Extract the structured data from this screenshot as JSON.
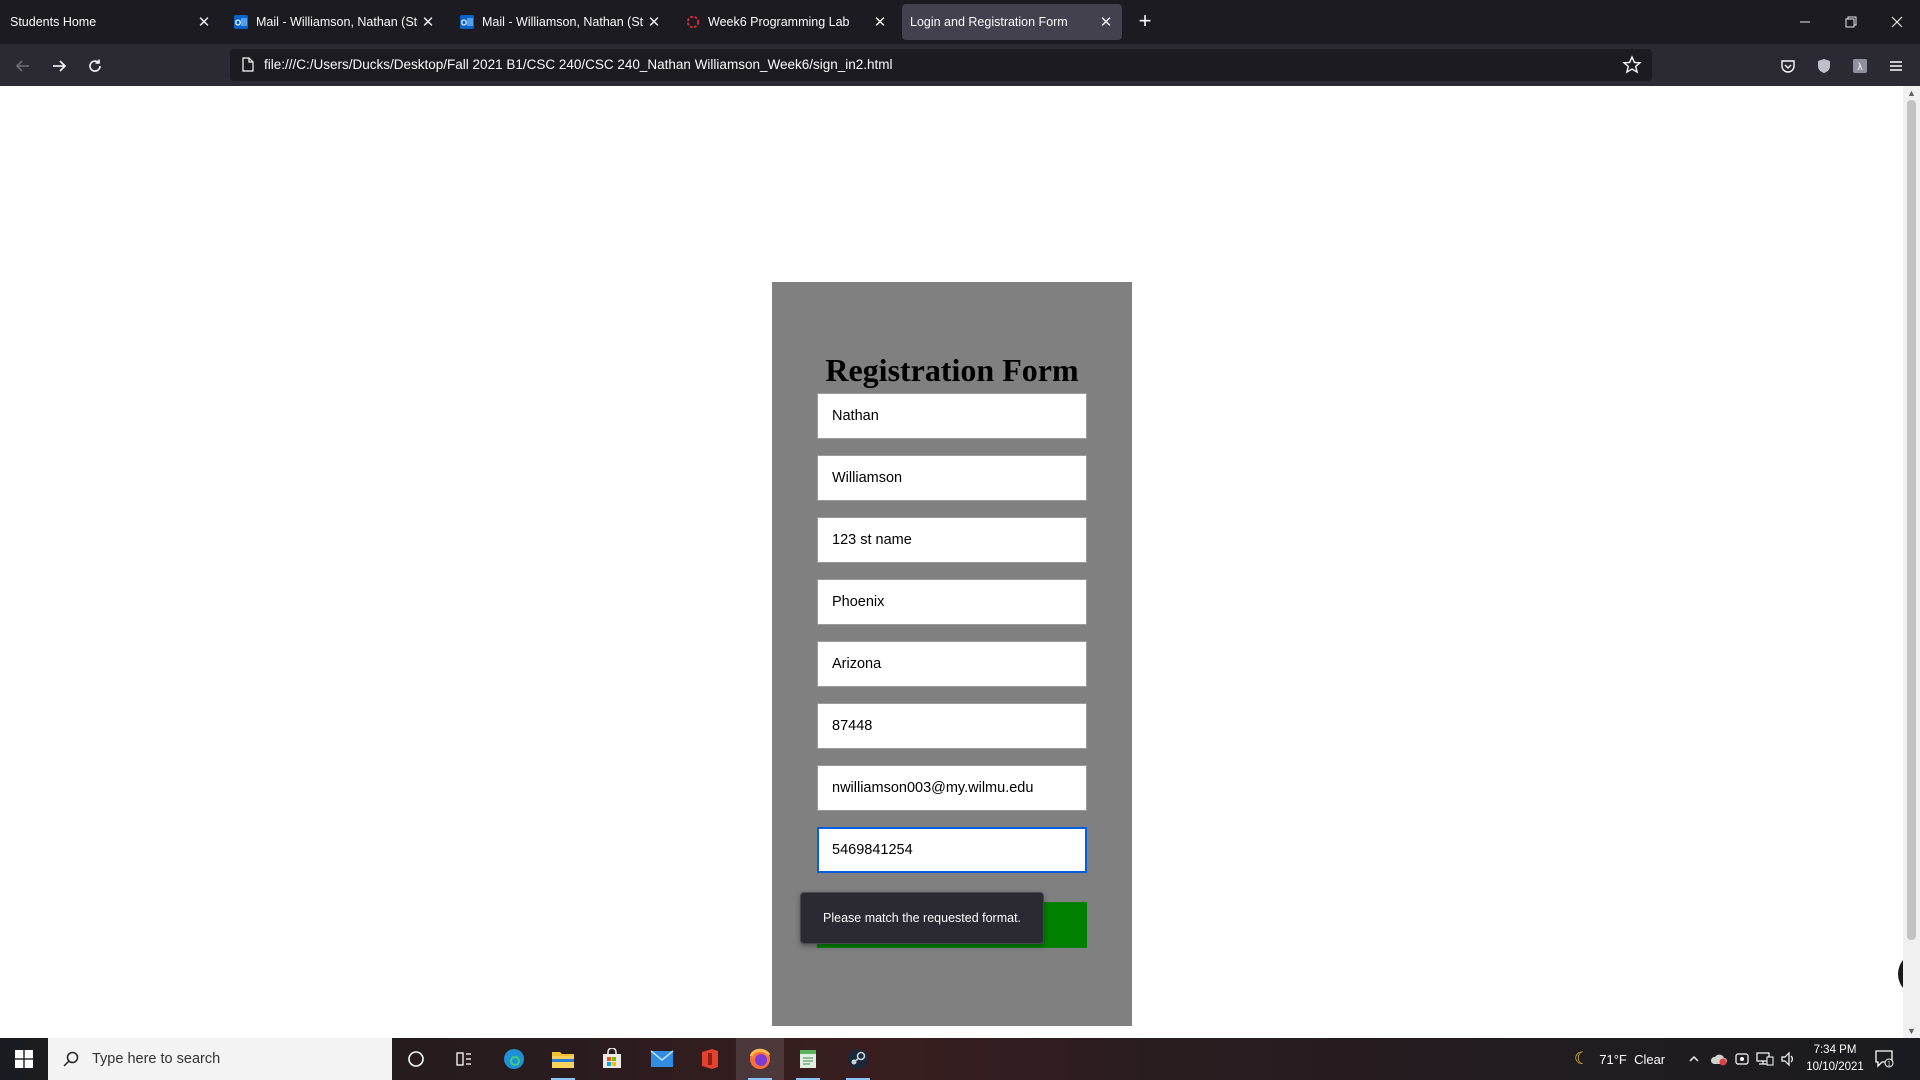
{
  "browser": {
    "tabs": [
      {
        "title": "Students Home",
        "icon": "blank",
        "active": false
      },
      {
        "title": "Mail - Williamson, Nathan (Stud",
        "icon": "outlook-icon",
        "active": false
      },
      {
        "title": "Mail - Williamson, Nathan (Stud",
        "icon": "outlook-icon",
        "active": false
      },
      {
        "title": "Week6 Programming Lab",
        "icon": "loading-icon",
        "active": false
      },
      {
        "title": "Login and Registration Form",
        "icon": "blank",
        "active": true
      }
    ],
    "url": "file:///C:/Users/Ducks/Desktop/Fall 2021 B1/CSC 240/CSC 240_Nathan Williamson_Week6/sign_in2.html"
  },
  "form": {
    "title": "Registration Form",
    "fields": [
      {
        "name": "first-name-field",
        "value": "Nathan"
      },
      {
        "name": "last-name-field",
        "value": "Williamson"
      },
      {
        "name": "address-field",
        "value": "123 st name"
      },
      {
        "name": "city-field",
        "value": "Phoenix"
      },
      {
        "name": "state-field",
        "value": "Arizona"
      },
      {
        "name": "zip-field",
        "value": "87448"
      },
      {
        "name": "email-field",
        "value": "nwilliamson003@my.wilmu.edu"
      },
      {
        "name": "phone-field",
        "value": "5469841254"
      }
    ],
    "validation_message": "Please match the requested format.",
    "submit_color": "#008000"
  },
  "taskbar": {
    "search_placeholder": "Type here to search",
    "weather": "71°F  Clear",
    "time": "7:34 PM",
    "date": "10/10/2021"
  }
}
